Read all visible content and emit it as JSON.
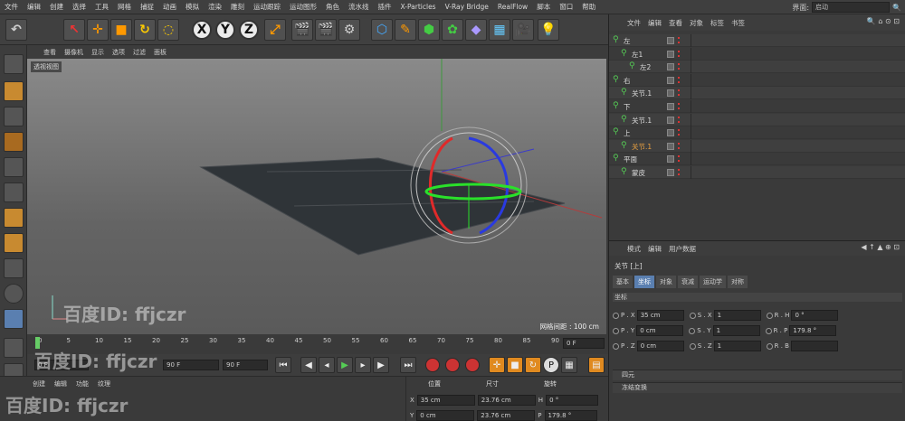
{
  "menu": [
    "文件",
    "编辑",
    "创建",
    "选择",
    "工具",
    "网格",
    "捕捉",
    "动画",
    "模拟",
    "渲染",
    "雕刻",
    "运动跟踪",
    "运动图形",
    "角色",
    "流水线",
    "插件",
    "X-Particles",
    "V-Ray Bridge",
    "RealFlow",
    "脚本",
    "窗口",
    "帮助"
  ],
  "layout": {
    "label": "界面:",
    "value": "启动"
  },
  "toolbar": {
    "x": "X",
    "y": "Y",
    "z": "Z"
  },
  "viewport": {
    "menu": [
      "查看",
      "摄像机",
      "显示",
      "选项",
      "过滤",
      "面板"
    ],
    "label": "透视视图",
    "grid": "网格间距 : 100 cm"
  },
  "timeline": {
    "ticks": [
      "0",
      "5",
      "10",
      "15",
      "20",
      "25",
      "30",
      "35",
      "40",
      "45",
      "50",
      "55",
      "60",
      "65",
      "70",
      "75",
      "80",
      "85",
      "90"
    ],
    "current": "0 F",
    "start": "0 F",
    "end": "90 F",
    "end2": "90 F"
  },
  "materials": {
    "menu": [
      "创建",
      "编辑",
      "功能",
      "纹理"
    ]
  },
  "coords": {
    "headers": [
      "位置",
      "尺寸",
      "旋转"
    ],
    "rows": [
      {
        "a": "X",
        "pv": "35 cm",
        "sv": "23.76 cm",
        "r": "H",
        "rv": "0 °"
      },
      {
        "a": "Y",
        "pv": "0 cm",
        "sv": "23.76 cm",
        "r": "P",
        "rv": "179.8 °"
      }
    ]
  },
  "objects": {
    "menu": [
      "文件",
      "编辑",
      "查看",
      "对象",
      "标签",
      "书签"
    ],
    "items": [
      {
        "name": "左",
        "indent": 0
      },
      {
        "name": "左1",
        "indent": 1
      },
      {
        "name": "左2",
        "indent": 2
      },
      {
        "name": "右",
        "indent": 0
      },
      {
        "name": "关节.1",
        "indent": 1
      },
      {
        "name": "下",
        "indent": 0
      },
      {
        "name": "关节.1",
        "indent": 1
      },
      {
        "name": "上",
        "indent": 0
      },
      {
        "name": "关节.1",
        "indent": 1,
        "selected": true
      },
      {
        "name": "平面",
        "indent": 0
      },
      {
        "name": "蒙皮",
        "indent": 1
      }
    ]
  },
  "attributes": {
    "menu": [
      "模式",
      "编辑",
      "用户数据"
    ],
    "title": "关节 [上]",
    "tabs": [
      "基本",
      "坐标",
      "对象",
      "衰减",
      "运动学",
      "对称"
    ],
    "active_tab": "坐标",
    "section": "坐标",
    "rows": [
      {
        "p": "P . X",
        "pv": "35 cm",
        "s": "S . X",
        "sv": "1",
        "r": "R . H",
        "rv": "0 °"
      },
      {
        "p": "P . Y",
        "pv": "0 cm",
        "s": "S . Y",
        "sv": "1",
        "r": "R . P",
        "rv": "179.8 °"
      },
      {
        "p": "P . Z",
        "pv": "0 cm",
        "s": "S . Z",
        "sv": "1",
        "r": "R . B",
        "rv": ""
      }
    ],
    "folds": [
      "四元",
      "冻结变换"
    ]
  },
  "watermark": {
    "text": "百度ID: ffjczr"
  }
}
